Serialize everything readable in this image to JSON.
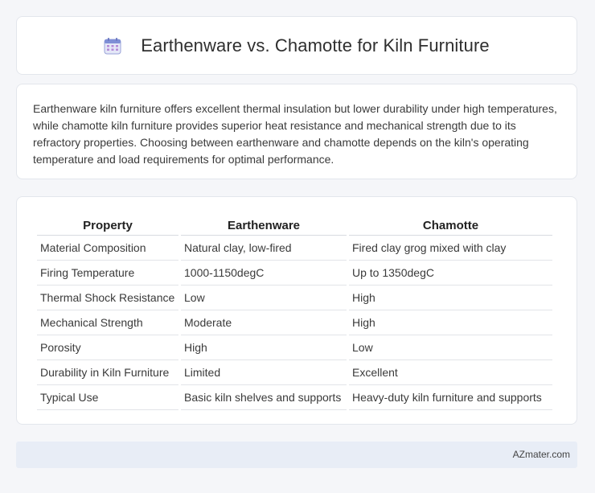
{
  "header": {
    "title": "Earthenware vs. Chamotte for Kiln Furniture",
    "icon": "calendar-icon"
  },
  "intro": {
    "text": "Earthenware kiln furniture offers excellent thermal insulation but lower durability under high temperatures, while chamotte kiln furniture provides superior heat resistance and mechanical strength due to its refractory properties. Choosing between earthenware and chamotte depends on the kiln's operating temperature and load requirements for optimal performance."
  },
  "table": {
    "headers": [
      "Property",
      "Earthenware",
      "Chamotte"
    ],
    "rows": [
      [
        "Material Composition",
        "Natural clay, low-fired",
        "Fired clay grog mixed with clay"
      ],
      [
        "Firing Temperature",
        "1000-1150degC",
        "Up to 1350degC"
      ],
      [
        "Thermal Shock Resistance",
        "Low",
        "High"
      ],
      [
        "Mechanical Strength",
        "Moderate",
        "High"
      ],
      [
        "Porosity",
        "High",
        "Low"
      ],
      [
        "Durability in Kiln Furniture",
        "Limited",
        "Excellent"
      ],
      [
        "Typical Use",
        "Basic kiln shelves and supports",
        "Heavy-duty kiln furniture and supports"
      ]
    ]
  },
  "footer": {
    "text": "AZmater.com"
  }
}
